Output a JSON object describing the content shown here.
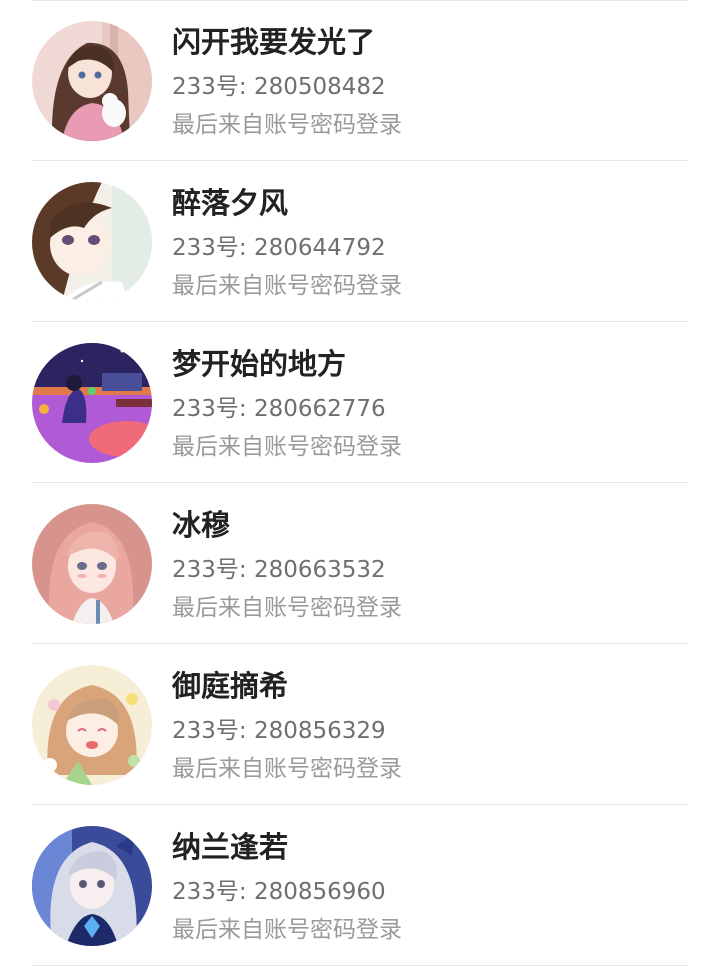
{
  "accounts": [
    {
      "name": "闪开我要发光了",
      "id_text": "233号: 280508482",
      "last_login": "最后来自账号密码登录",
      "avatar": "avatar-girl-brown-hair-with-cat"
    },
    {
      "name": "醉落夕风",
      "id_text": "233号: 280644792",
      "last_login": "最后来自账号密码登录",
      "avatar": "avatar-girl-dark-hair-closeup"
    },
    {
      "name": "梦开始的地方",
      "id_text": "233号: 280662776",
      "last_login": "最后来自账号密码登录",
      "avatar": "avatar-purple-room-illustration"
    },
    {
      "name": "冰穆",
      "id_text": "233号: 280663532",
      "last_login": "最后来自账号密码登录",
      "avatar": "avatar-girl-pink-hair"
    },
    {
      "name": "御庭摘希",
      "id_text": "233号: 280856329",
      "last_login": "最后来自账号密码登录",
      "avatar": "avatar-girl-flowers-light-hair"
    },
    {
      "name": "纳兰逢若",
      "id_text": "233号: 280856960",
      "last_login": "最后来自账号密码登录",
      "avatar": "avatar-girl-silver-hair-blue"
    }
  ],
  "colors": {
    "name": "#222222",
    "id_text": "#6f6f6f",
    "last_login": "#9a9a9a",
    "divider": "#e6e6e6",
    "background": "#ffffff"
  }
}
